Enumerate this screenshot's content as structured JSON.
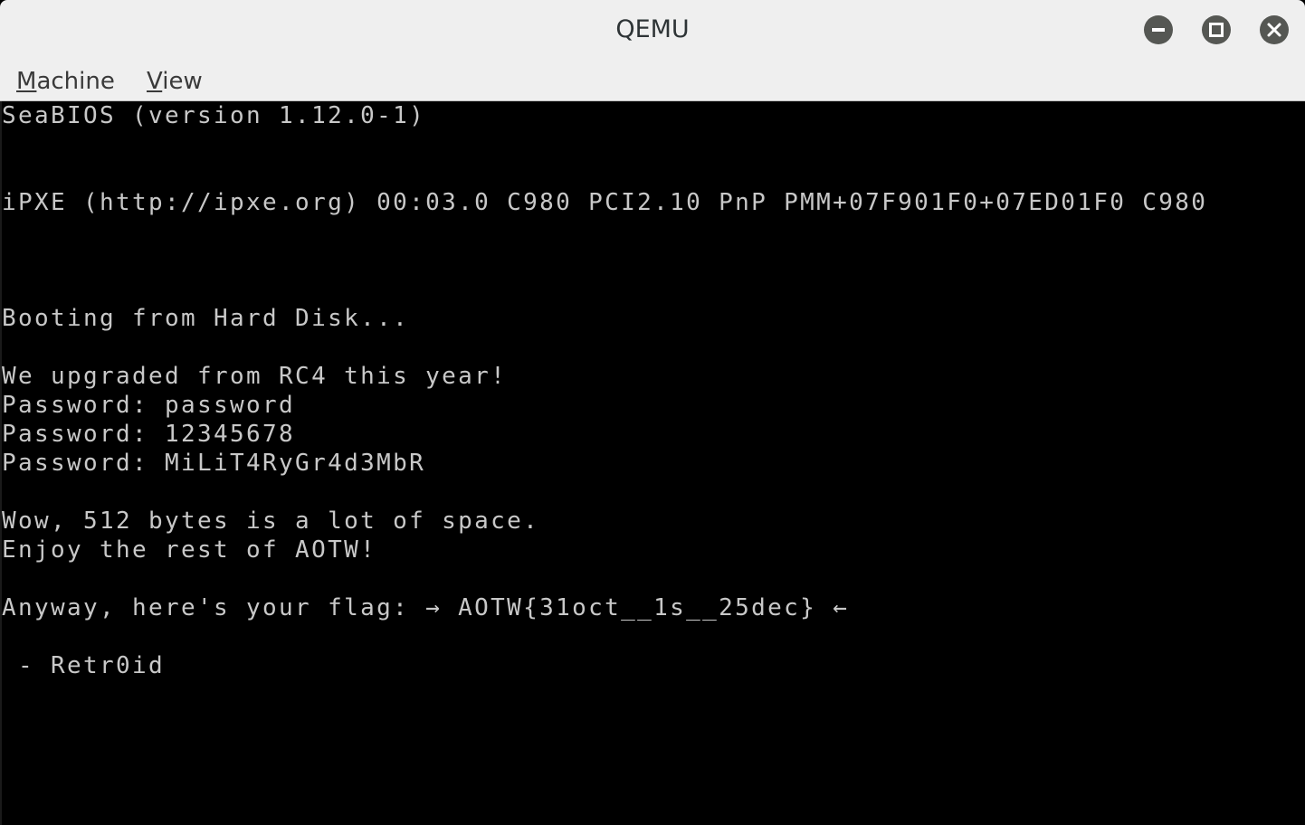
{
  "window": {
    "title": "QEMU",
    "buttons": {
      "minimize_icon": "minimize-icon",
      "maximize_icon": "maximize-icon",
      "close_icon": "close-icon"
    }
  },
  "menubar": {
    "items": [
      {
        "label_accel": "M",
        "label_rest": "achine"
      },
      {
        "label_accel": "V",
        "label_rest": "iew"
      }
    ]
  },
  "console": {
    "lines": [
      "SeaBIOS (version 1.12.0-1)",
      "iPXE (http://ipxe.org) 00:03.0 C980 PCI2.10 PnP PMM+07F901F0+07ED01F0 C980",
      "Booting from Hard Disk...",
      "We upgraded from RC4 this year!",
      "Password: password",
      "Password: 12345678",
      "Password: MiLiT4RyGr4d3MbR",
      "Wow, 512 bytes is a lot of space.",
      "Enjoy the rest of AOTW!",
      "Anyway, here's your flag: → AOTW{31oct__1s__25dec} ←",
      " - Retr0id"
    ],
    "text_color": "#c8c8c8",
    "background": "#000000"
  }
}
